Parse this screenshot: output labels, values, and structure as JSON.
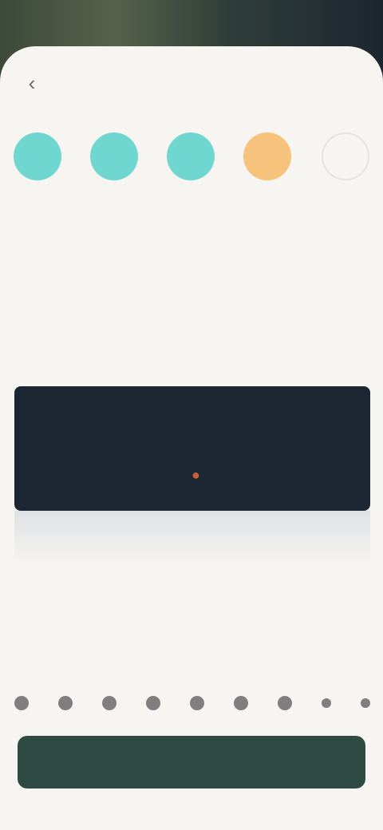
{
  "header": {
    "title": "",
    "back_icon": "chevron-left-icon"
  },
  "steps": [
    {
      "label": "",
      "color": "#6fd6d0",
      "state": "done"
    },
    {
      "label": "",
      "color": "#6fd6d0",
      "state": "done"
    },
    {
      "label": "",
      "color": "#6fd6d0",
      "state": "done"
    },
    {
      "label": "",
      "color": "#f6c27c",
      "state": "current"
    },
    {
      "label": "",
      "color": "#e4e4e4",
      "state": "pending"
    }
  ],
  "content": {
    "headline": "",
    "subline": ""
  },
  "panel": {
    "tabs": [
      "",
      "",
      ""
    ],
    "active_tab": 1,
    "pointer_icon": "pointer-icon",
    "accent_color": "#c56033"
  },
  "scale": {
    "count": 9
  },
  "cta": {
    "label": "",
    "color": "#2f4a42"
  },
  "colors": {
    "sheet": "#f7f5f2",
    "panel": "#1d2733"
  }
}
